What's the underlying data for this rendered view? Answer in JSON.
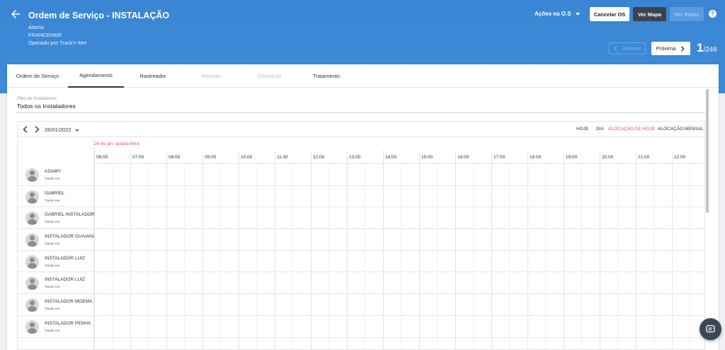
{
  "header": {
    "title": "Ordem de Serviço - INSTALAÇÃO",
    "status": "Aberta",
    "client": "FRANCENME",
    "operator": "Operado por Track'n Me!",
    "actions_menu": "Ações na O.S",
    "cancel_button": "Cancelar OS",
    "map_button": "Ver Mapa",
    "routes_button": "Ver Rotas",
    "help": "?",
    "prev_button": "Anterior",
    "next_button": "Próxima",
    "current_index": "1",
    "total": "/246"
  },
  "tabs": [
    {
      "label": "Ordem de Serviço",
      "state": "normal"
    },
    {
      "label": "Agendamento",
      "state": "active"
    },
    {
      "label": "Rastreador",
      "state": "normal"
    },
    {
      "label": "Revisão",
      "state": "disabled"
    },
    {
      "label": "CheckList",
      "state": "disabled"
    },
    {
      "label": "Tratamento",
      "state": "normal"
    }
  ],
  "filter": {
    "label": "Filtro de Instaladores",
    "value": "Todos os Instaladores"
  },
  "calendar": {
    "date": "26/01/2022",
    "views": {
      "today": "HOJE",
      "day": "DIA",
      "today_alloc": "ALOCAÇÃO DE HOJE",
      "monthly_alloc": "ALOCAÇÃO MENSAL"
    },
    "day_label": "26 de jan, quarta-feira",
    "hours": [
      "06:00",
      "07:00",
      "08:00",
      "09:00",
      "10:00",
      "11:00",
      "12:00",
      "13:00",
      "14:00",
      "15:00",
      "16:00",
      "17:00",
      "18:00",
      "19:00",
      "20:00",
      "21:00",
      "22:00"
    ],
    "installers": [
      {
        "name": "ADAMY",
        "company": "Trackn me"
      },
      {
        "name": "GABRIEL",
        "company": "Trackn me"
      },
      {
        "name": "GABRIEL INSTALADOR",
        "company": "Trackn me"
      },
      {
        "name": "INSTALADOR GUAIANA",
        "company": "Trackn me"
      },
      {
        "name": "INSTALADOR LUIZ",
        "company": "Trackn me"
      },
      {
        "name": "INSTALADOR LUIZ",
        "company": "Trackn me"
      },
      {
        "name": "INSTALADOR MOEMA",
        "company": "Trackn me"
      },
      {
        "name": "INSTALADOR PENHA",
        "company": "Trackn me"
      }
    ]
  },
  "colors": {
    "header_bg": "#3a86d4",
    "accent_pink": "#e94b76",
    "dark_button": "#3b4350"
  }
}
